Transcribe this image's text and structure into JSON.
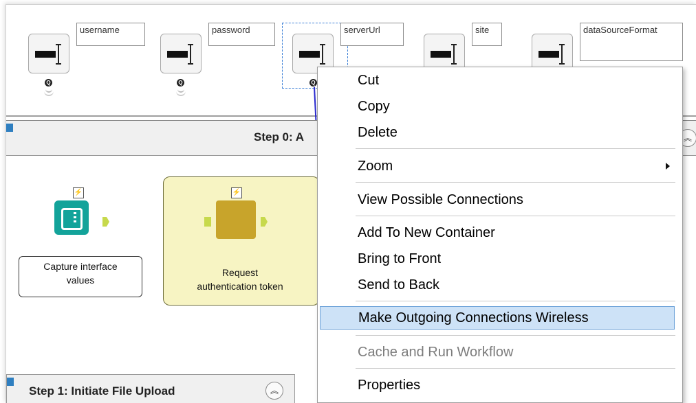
{
  "inputs": [
    {
      "label": "username"
    },
    {
      "label": "password"
    },
    {
      "label": "serverUrl"
    },
    {
      "label": "site"
    },
    {
      "label": "dataSourceFormat"
    }
  ],
  "container0": {
    "title": "Step 0: A",
    "collapse_glyph": "︽"
  },
  "nodes": {
    "capture": {
      "caption": "Capture interface values"
    },
    "request": {
      "caption_line1": "Request",
      "caption_line2": "authentication token"
    }
  },
  "container1": {
    "title": "Step 1: Initiate File Upload",
    "collapse_glyph": "︽"
  },
  "context_menu": {
    "items": [
      {
        "label": "Cut"
      },
      {
        "label": "Copy"
      },
      {
        "label": "Delete"
      },
      {
        "label": "Zoom"
      },
      {
        "label": "View Possible Connections"
      },
      {
        "label": "Add To New Container"
      },
      {
        "label": "Bring to Front"
      },
      {
        "label": "Send to Back"
      },
      {
        "label": "Make Outgoing Connections Wireless"
      },
      {
        "label": "Cache and Run Workflow"
      },
      {
        "label": "Properties"
      }
    ]
  },
  "icons": {
    "flag": "lightning-bolt-icon",
    "q": "Q"
  },
  "colors": {
    "highlight": "#cde2f7",
    "teal_tool": "#13a39a",
    "gold_tool": "#c8a42b",
    "connection": "#2a2ad0"
  }
}
